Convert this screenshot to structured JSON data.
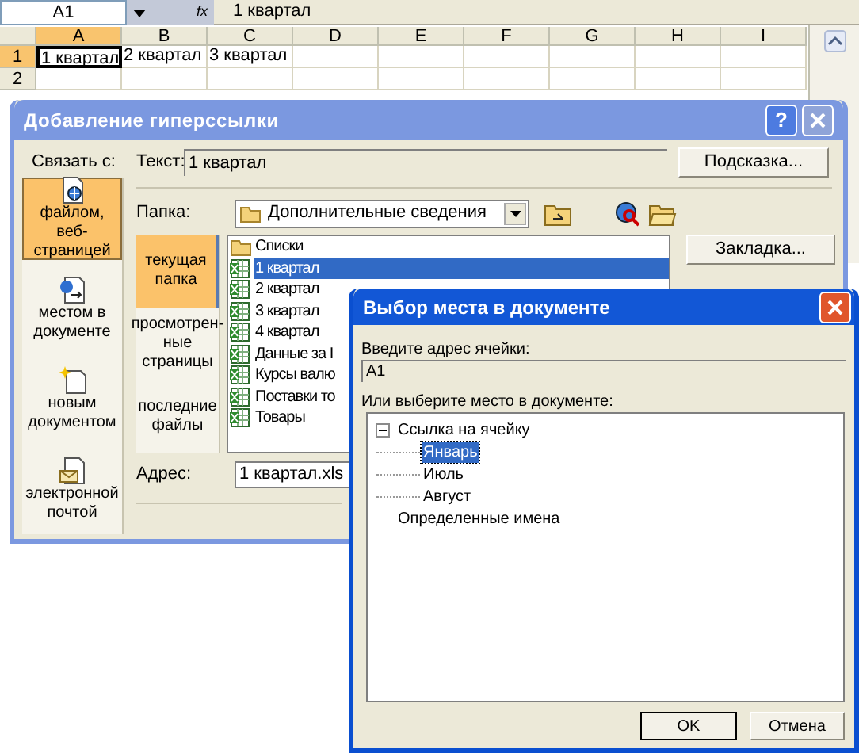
{
  "formula_bar": {
    "name_box": "A1",
    "fx": "fx",
    "formula": "1 квартал"
  },
  "sheet": {
    "columns": [
      {
        "label": "A",
        "selected": true
      },
      {
        "label": "B",
        "selected": false
      },
      {
        "label": "C",
        "selected": false
      },
      {
        "label": "D",
        "selected": false
      },
      {
        "label": "E",
        "selected": false
      },
      {
        "label": "F",
        "selected": false
      },
      {
        "label": "G",
        "selected": false
      },
      {
        "label": "H",
        "selected": false
      },
      {
        "label": "I",
        "selected": false
      }
    ],
    "rows": [
      {
        "label": "1",
        "selected": true,
        "cells": [
          {
            "text": "1 квартал",
            "selected": true
          },
          {
            "text": "2 квартал",
            "selected": false
          },
          {
            "text": "3 квартал",
            "selected": false
          }
        ]
      },
      {
        "label": "2",
        "selected": false
      }
    ]
  },
  "hyperlink_dialog": {
    "title": "Добавление гиперссылки",
    "link_label": "Связать с:",
    "link_targets": [
      {
        "label": "файлом, веб-страницей",
        "kind": "file",
        "selected": true
      },
      {
        "label": "местом в документе",
        "kind": "place",
        "selected": false
      },
      {
        "label": "новым документом",
        "kind": "new",
        "selected": false
      },
      {
        "label": "электронной почтой",
        "kind": "email",
        "selected": false
      }
    ],
    "help_button": "?",
    "text_label": "Текст:",
    "text_value": "1 квартал",
    "tooltip_button": "Подсказка...",
    "folder_label": "Папка:",
    "folder": "Дополнительные сведения",
    "views": [
      {
        "label": "текущая папка",
        "selected": true
      },
      {
        "label": "просмотрен-ные страницы",
        "selected": false
      },
      {
        "label": "последние файлы",
        "selected": false
      }
    ],
    "files": [
      {
        "name": "Списки",
        "kind": "folder",
        "selected": false
      },
      {
        "name": "1 квартал",
        "kind": "workbook",
        "selected": true
      },
      {
        "name": "2 квартал",
        "kind": "workbook",
        "selected": false
      },
      {
        "name": "3 квартал",
        "kind": "workbook",
        "selected": false
      },
      {
        "name": "4 квартал",
        "kind": "workbook",
        "selected": false
      },
      {
        "name": "Данные за I",
        "kind": "workbook",
        "selected": false
      },
      {
        "name": "Курсы валю",
        "kind": "workbook",
        "selected": false
      },
      {
        "name": "Поставки то",
        "kind": "workbook",
        "selected": false
      },
      {
        "name": "Товары",
        "kind": "workbook",
        "selected": false
      }
    ],
    "bookmark_button": "Закладка...",
    "address_label": "Адрес:",
    "address": "1 квартал.xls"
  },
  "place_dialog": {
    "title": "Выбор места в документе",
    "cell_label": "Введите адрес ячейки:",
    "cell_value": "A1",
    "tree_label": "Или выберите место в документе:",
    "tree": [
      {
        "label": "Ссылка на ячейку",
        "selected": false,
        "expanded": true,
        "children": [
          {
            "label": "Январь",
            "selected": true
          },
          {
            "label": "Июль",
            "selected": false
          },
          {
            "label": "Август",
            "selected": false
          }
        ]
      },
      {
        "label": "Определенные имена",
        "selected": false
      }
    ],
    "ok_button": "OK",
    "cancel_button": "Отмена"
  }
}
